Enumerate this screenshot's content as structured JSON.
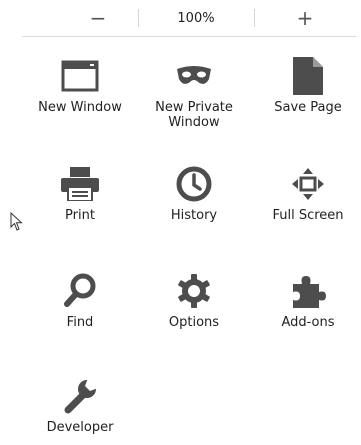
{
  "zoom": {
    "out_label": "−",
    "level": "100%",
    "in_label": "+"
  },
  "items": [
    {
      "label": "New Window",
      "icon": "window-icon"
    },
    {
      "label": "New Private\nWindow",
      "icon": "mask-icon"
    },
    {
      "label": "Save Page",
      "icon": "document-icon"
    },
    {
      "label": "Print",
      "icon": "printer-icon"
    },
    {
      "label": "History",
      "icon": "clock-icon"
    },
    {
      "label": "Full Screen",
      "icon": "fullscreen-icon"
    },
    {
      "label": "Find",
      "icon": "magnifier-icon"
    },
    {
      "label": "Options",
      "icon": "gear-icon"
    },
    {
      "label": "Add-ons",
      "icon": "puzzle-icon"
    },
    {
      "label": "Developer",
      "icon": "wrench-icon"
    }
  ],
  "colors": {
    "icon": "#4d4d4d",
    "separator": "#dcdcdc"
  }
}
